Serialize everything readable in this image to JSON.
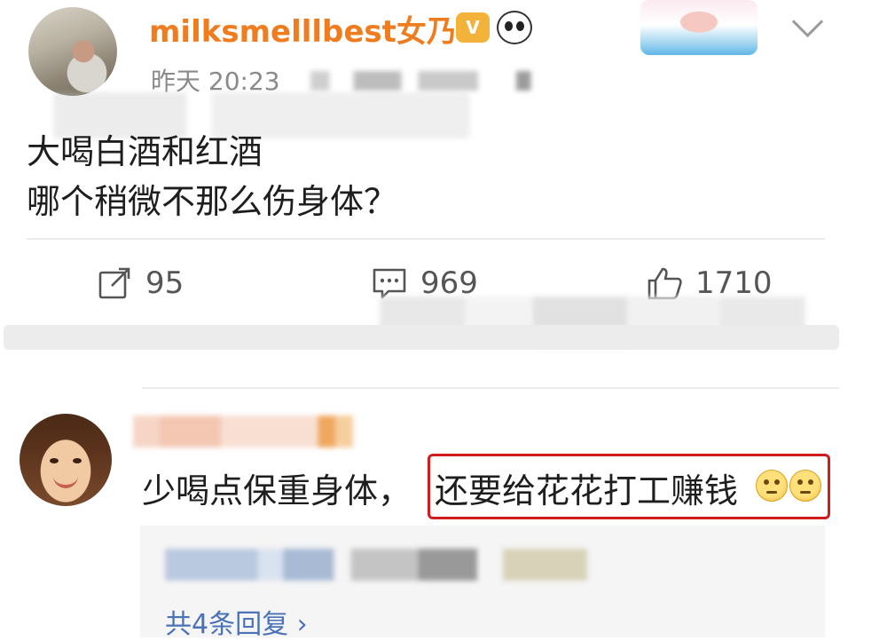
{
  "post": {
    "username": "milksmelllbest女乃",
    "vip_badge": "V",
    "timestamp": "昨天 20:23",
    "body_line1": "大喝白酒和红酒",
    "body_line2": "哪个稍微不那么伤身体？"
  },
  "actions": {
    "repost_count": "95",
    "comment_count": "969",
    "like_count": "1710"
  },
  "comment": {
    "text_before": "少喝点保重身体，",
    "text_highlighted": "还要给花花打工赚钱",
    "emojis": [
      "sad-face-icon",
      "sad-face-icon"
    ],
    "highlight_color": "#d11d1d"
  },
  "replies": {
    "link": "共4条回复 ›"
  },
  "colors": {
    "username": "#ef7c1f",
    "link": "#4a72b8",
    "timestamp": "#8a8a8a"
  }
}
